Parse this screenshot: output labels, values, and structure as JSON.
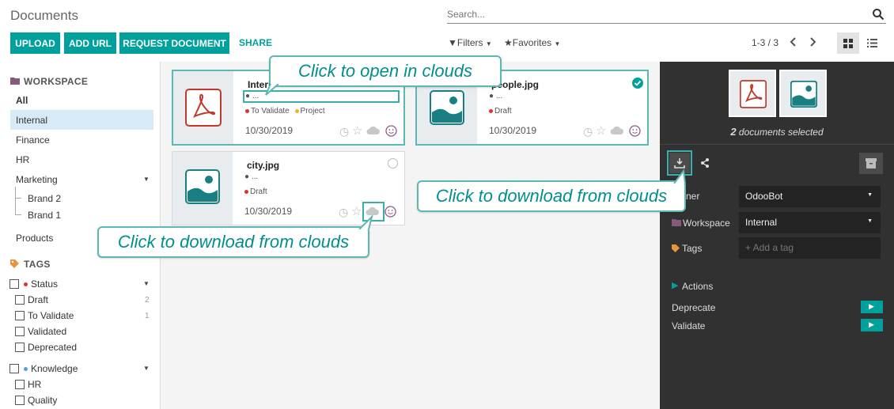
{
  "app": {
    "title": "Documents"
  },
  "search": {
    "placeholder": "Search..."
  },
  "toolbar": {
    "upload": "UPLOAD",
    "add_url": "ADD URL",
    "request_document": "REQUEST DOCUMENT",
    "share": "SHARE",
    "filters": "Filters",
    "favorites": "Favorites",
    "pager": "1-3 / 3"
  },
  "sidebar": {
    "workspace_heading": "WORKSPACE",
    "workspaces": [
      "All",
      "Internal",
      "Finance",
      "HR",
      "Marketing",
      "Brand 2",
      "Brand 1",
      "Products"
    ],
    "selected": "Internal",
    "tags_heading": "TAGS",
    "status_label": "Status",
    "status_items": [
      {
        "label": "Draft",
        "count": "2"
      },
      {
        "label": "To Validate",
        "count": "1"
      },
      {
        "label": "Validated",
        "count": ""
      },
      {
        "label": "Deprecated",
        "count": ""
      }
    ],
    "knowledge_label": "Knowledge",
    "knowledge_items": [
      "HR",
      "Quality"
    ]
  },
  "cards": [
    {
      "name": "Interior Design Brochure.pdf",
      "shown_name": "Interio",
      "owner": "...",
      "tags": [
        "To Validate",
        "Project"
      ],
      "date": "10/30/2019",
      "selected": true,
      "type": "pdf"
    },
    {
      "name": "people.jpg",
      "shown_name": "people.jpg",
      "owner": "...",
      "tags": [
        "Draft"
      ],
      "date": "10/30/2019",
      "selected": true,
      "type": "image"
    },
    {
      "name": "city.jpg",
      "shown_name": "city.jpg",
      "owner": "...",
      "tags": [
        "Draft"
      ],
      "date": "10/30/2019",
      "selected": false,
      "type": "image"
    }
  ],
  "panel": {
    "selected_count": "2",
    "selected_text": "documents selected",
    "owner_label": "Owner",
    "owner_value": "OdooBot",
    "workspace_label": "Workspace",
    "workspace_value": "Internal",
    "tags_label": "Tags",
    "tags_placeholder": "+ Add a tag",
    "actions_label": "Actions",
    "actions": [
      "Deprecate",
      "Validate"
    ]
  },
  "callouts": {
    "open": "Click to open in clouds",
    "download_card": "Click to download from clouds",
    "download_panel": "Click to download from clouds"
  },
  "colors": {
    "accent": "#00a09d",
    "panel_bg": "#313131",
    "pdf_red": "#c0392b",
    "callout_border": "#5cb8b2"
  }
}
